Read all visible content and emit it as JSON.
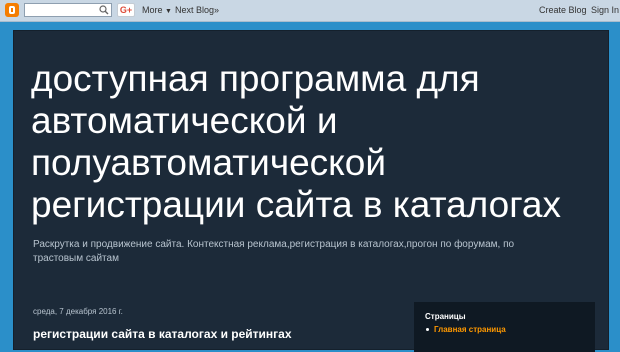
{
  "navbar": {
    "gplus_label": "G+",
    "more_label": "More",
    "next_blog_label": "Next Blog»",
    "create_blog_label": "Create Blog",
    "sign_in_label": "Sign In",
    "search_placeholder": ""
  },
  "header": {
    "title": "доступная программа для автоматической и полуавтоматической регистрации сайта в каталогах",
    "description": "Раскрутка и продвижение сайта. Контекстная реклама,регистрация в каталогах,прогон по форумам, по трастовым сайтам"
  },
  "post": {
    "date": "среда, 7 декабря 2016 г.",
    "title": "регистрации сайта в каталогах и рейтингах"
  },
  "sidebar": {
    "title": "Страницы",
    "items": [
      {
        "label": "Главная страница"
      }
    ]
  },
  "colors": {
    "background": "#2b8fc9",
    "content": "#1c2a39",
    "sidebar": "#0f1923",
    "accent_link": "#ff9900"
  }
}
